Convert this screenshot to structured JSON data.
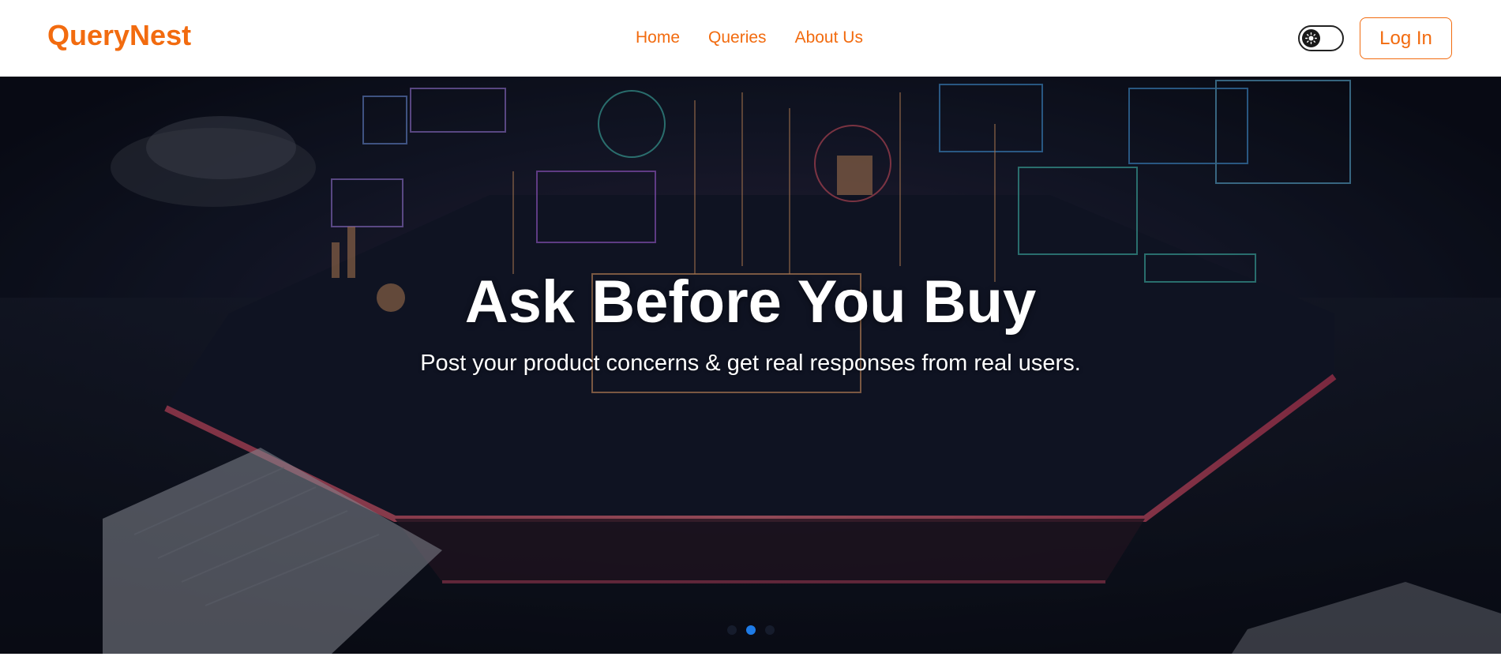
{
  "header": {
    "brand": "QueryNest",
    "nav": [
      {
        "label": "Home"
      },
      {
        "label": "Queries"
      },
      {
        "label": "About Us"
      }
    ],
    "theme_toggle_icon": "sun-icon",
    "login_label": "Log In"
  },
  "hero": {
    "title": "Ask Before You Buy",
    "subtitle": "Post your product concerns & get real responses from real users.",
    "carousel": {
      "slide_count": 3,
      "active_index": 1
    }
  },
  "colors": {
    "brand": "#f26b0f",
    "dot_active": "#1e7be6"
  }
}
